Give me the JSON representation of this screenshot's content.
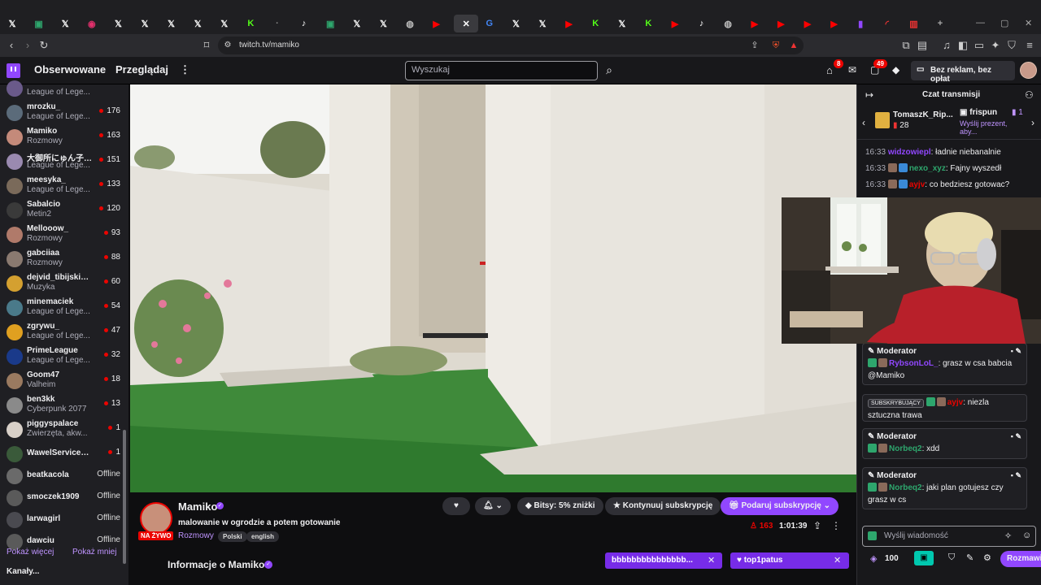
{
  "browser": {
    "tabs": [
      {
        "icon": "x-icon",
        "label": "𝕏",
        "color": "#ffffff"
      },
      {
        "icon": "ext-icon",
        "label": "▣",
        "color": "#2ea66d"
      },
      {
        "icon": "x-icon",
        "label": "𝕏",
        "color": "#ffffff"
      },
      {
        "icon": "instagram-icon",
        "label": "◉",
        "color": "#e1306c"
      },
      {
        "icon": "x-icon",
        "label": "𝕏",
        "color": "#ffffff"
      },
      {
        "icon": "x-icon",
        "label": "𝕏",
        "color": "#ffffff"
      },
      {
        "icon": "x-icon",
        "label": "𝕏",
        "color": "#ffffff"
      },
      {
        "icon": "x-icon",
        "label": "𝕏",
        "color": "#ffffff"
      },
      {
        "icon": "x-icon",
        "label": "𝕏",
        "color": "#ffffff"
      },
      {
        "icon": "kick-icon",
        "label": "K",
        "color": "#53fc18"
      },
      {
        "icon": "loading-icon",
        "label": "·",
        "color": "#888888"
      },
      {
        "icon": "tiktok-icon",
        "label": "♪",
        "color": "#ffffff"
      },
      {
        "icon": "ext-icon",
        "label": "▣",
        "color": "#2ea66d"
      },
      {
        "icon": "x-icon",
        "label": "𝕏",
        "color": "#ffffff"
      },
      {
        "icon": "x-icon",
        "label": "𝕏",
        "color": "#ffffff"
      },
      {
        "icon": "globe-icon",
        "label": "◍",
        "color": "#bbbbbb"
      },
      {
        "icon": "youtube-icon",
        "label": "▶",
        "color": "#ff0000"
      },
      {
        "icon": "close-icon",
        "label": "✕",
        "color": "#ffffff",
        "active": true
      },
      {
        "icon": "google-icon",
        "label": "G",
        "color": "#4285f4"
      },
      {
        "icon": "x-icon",
        "label": "𝕏",
        "color": "#ffffff"
      },
      {
        "icon": "x-icon",
        "label": "𝕏",
        "color": "#ffffff"
      },
      {
        "icon": "youtube-icon",
        "label": "▶",
        "color": "#ff0000"
      },
      {
        "icon": "kick-icon",
        "label": "K",
        "color": "#53fc18"
      },
      {
        "icon": "x-icon",
        "label": "𝕏",
        "color": "#ffffff"
      },
      {
        "icon": "kick-icon",
        "label": "K",
        "color": "#53fc18"
      },
      {
        "icon": "youtube-icon",
        "label": "▶",
        "color": "#ff0000"
      },
      {
        "icon": "tiktok-icon",
        "label": "♪",
        "color": "#ffffff"
      },
      {
        "icon": "globe-icon",
        "label": "◍",
        "color": "#bbbbbb"
      },
      {
        "icon": "youtube-icon",
        "label": "▶",
        "color": "#ff0000"
      },
      {
        "icon": "youtube-icon",
        "label": "▶",
        "color": "#ff0000"
      },
      {
        "icon": "youtube-icon",
        "label": "▶",
        "color": "#ff0000"
      },
      {
        "icon": "youtube-icon",
        "label": "▶",
        "color": "#ff0000"
      },
      {
        "icon": "twitch-icon",
        "label": "▮",
        "color": "#9147ff"
      },
      {
        "icon": "loading-icon",
        "label": "◜",
        "color": "#e33"
      },
      {
        "icon": "chart-icon",
        "label": "▥",
        "color": "#e33"
      },
      {
        "icon": "plus-icon",
        "label": "+",
        "color": "#aaaaaa"
      }
    ],
    "url": "twitch.tv/mamiko"
  },
  "topnav": {
    "following": "Obserwowane",
    "browse": "Przeglądaj",
    "search_placeholder": "Wyszukaj",
    "notifications_count": "8",
    "activity_count": "49",
    "prime_label": "Bez reklam, bez opłat"
  },
  "sidebar": {
    "channels": [
      {
        "name": "",
        "game": "League of Lege...",
        "viewers": "",
        "color": "#6a5a8a"
      },
      {
        "name": "mrozku_",
        "game": "League of Lege...",
        "viewers": "176",
        "color": "#5b6b7a"
      },
      {
        "name": "Mamiko",
        "game": "Rozmowy",
        "viewers": "163",
        "color": "#c48a7a"
      },
      {
        "name": "大御所にゅん子 (...",
        "game": "League of Lege...",
        "viewers": "151",
        "color": "#9a8ab0"
      },
      {
        "name": "meesyka_",
        "game": "League of Lege...",
        "viewers": "133",
        "color": "#7a6a5a"
      },
      {
        "name": "Sabalcio",
        "game": "Metin2",
        "viewers": "120",
        "color": "#3a3a3a"
      },
      {
        "name": "Mellooow_",
        "game": "Rozmowy",
        "viewers": "93",
        "color": "#b07a6a"
      },
      {
        "name": "gabciiaa",
        "game": "Rozmowy",
        "viewers": "88",
        "color": "#8a7a70"
      },
      {
        "name": "dejvid_tibijski_...",
        "game": "Muzyka",
        "viewers": "60",
        "color": "#d4a030"
      },
      {
        "name": "minemaciek",
        "game": "League of Lege...",
        "viewers": "54",
        "color": "#4a7a8a"
      },
      {
        "name": "zgrywu_",
        "game": "League of Lege...",
        "viewers": "47",
        "color": "#e0a020"
      },
      {
        "name": "PrimeLeague",
        "game": "League of Lege...",
        "viewers": "32",
        "color": "#1a3a8a"
      },
      {
        "name": "Goom47",
        "game": "Valheim",
        "viewers": "18",
        "color": "#9a7a60"
      },
      {
        "name": "ben3kk",
        "game": "Cyberpunk 2077",
        "viewers": "13",
        "color": "#8a8a8a"
      },
      {
        "name": "piggyspalace",
        "game": "Zwierzęta, akw...",
        "viewers": "1",
        "color": "#d8d0c8"
      },
      {
        "name": "WawelServiceS...",
        "game": "",
        "viewers": "1",
        "color": "#3a5a3a"
      },
      {
        "name": "beatkacola",
        "game": "",
        "viewers": "Offline",
        "color": "#6a6a6a"
      },
      {
        "name": "smoczek1909",
        "game": "",
        "viewers": "Offline",
        "color": "#5a5a5a"
      },
      {
        "name": "larwagirl",
        "game": "",
        "viewers": "Offline",
        "color": "#4a4a50"
      },
      {
        "name": "dawciu",
        "game": "",
        "viewers": "Offline",
        "color": "#5a5a5a"
      }
    ],
    "show_more": "Pokaż więcej",
    "show_less": "Pokaż mniej",
    "section_cut": "Kanały..."
  },
  "stream": {
    "streamer": "Mamiko",
    "live_badge": "NA ŻYWO",
    "title": "malowanie w ogrodzie a potem gotowanie",
    "category": "Rozmowy",
    "tags": [
      "Polski",
      "english"
    ],
    "viewers": "163",
    "uptime": "1:01:39",
    "bits_label": "Bitsy: 5% zniżki",
    "continue_sub": "Kontynuuj subskrypcję",
    "gift_sub": "Podaruj subskrypcję",
    "about": "Informacje o Mamiko"
  },
  "chat": {
    "header": "Czat transmisji",
    "gift_user": "TomaszK_Rip...",
    "gift_count": "28",
    "gift_user2": "frispun",
    "gift_user2_count": "1",
    "gift_cta": "Wyślij prezent, aby...",
    "messages": [
      {
        "time": "16:33",
        "user": "widzowiepl",
        "text": ": ładnie niebanalnie",
        "color": "#9147ff"
      },
      {
        "time": "16:33",
        "user": "nexo_xyz",
        "text": ": Fajny wyszedł",
        "color": "#2ea66d"
      },
      {
        "time": "16:33",
        "user": "ayjv",
        "text": ": co bedziesz gotowac?",
        "color": "#eb0400"
      }
    ],
    "mod_label": "Moderator",
    "sub_label": "SUBSKRYBUJĄCY",
    "highlighted": [
      {
        "type": "mod",
        "user": "RybsonLoL_",
        "text": ": grasz w csa babcia @Mamiko",
        "color": "#9147ff"
      },
      {
        "type": "sub",
        "user": "ayjv",
        "text": ": niezla sztuczna trawa",
        "color": "#eb0400"
      },
      {
        "type": "mod",
        "user": "Norbeq2",
        "text": ": xdd",
        "color": "#2ea66d"
      },
      {
        "type": "mod",
        "user": "Norbeq2",
        "text": ": jaki plan gotujesz czy grasz w cs",
        "color": "#2ea66d"
      }
    ],
    "input_placeholder": "Wyślij wiadomość",
    "points": "100",
    "chat_button": "Rozmawiaj"
  },
  "bottom": {
    "bar1": "bbbbbbbbbbbbbbb...",
    "bar2": "top1patus"
  },
  "colors": {
    "twitch": "#9147ff",
    "live": "#eb0400",
    "bg": "#0e0e10"
  }
}
